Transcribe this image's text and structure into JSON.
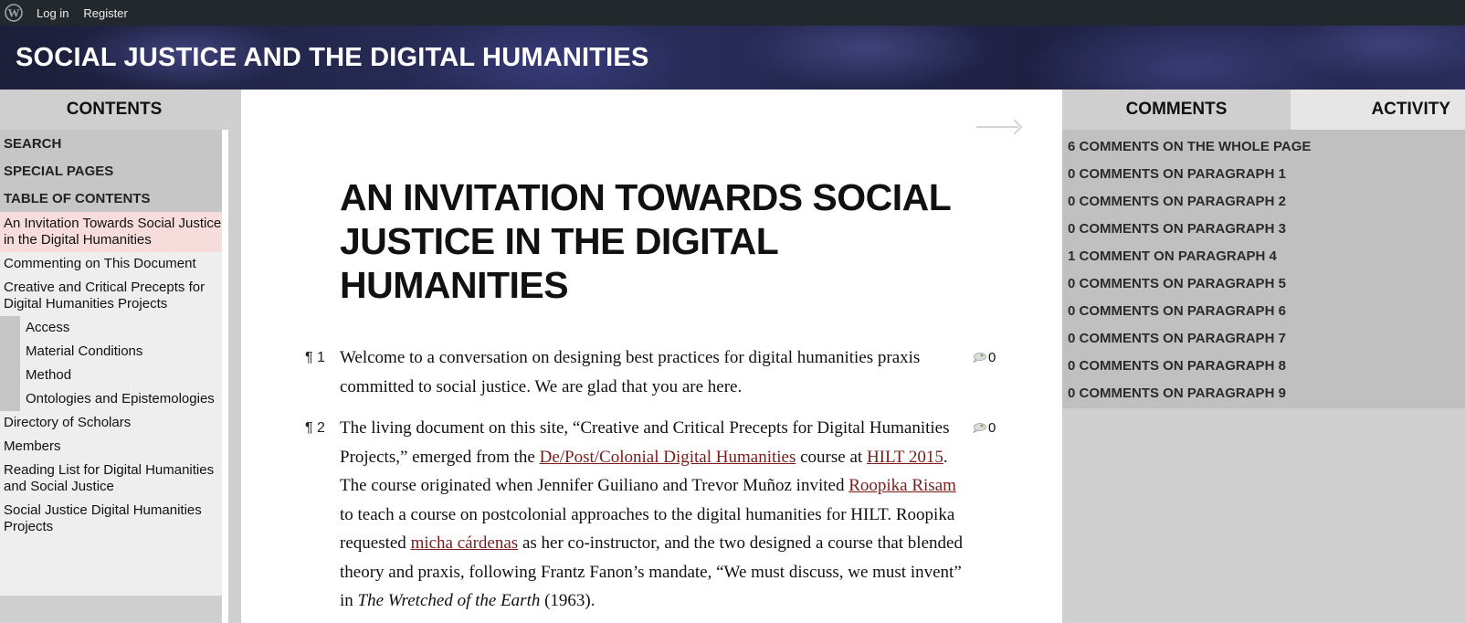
{
  "adminbar": {
    "login": "Log in",
    "register": "Register"
  },
  "site": {
    "title": "SOCIAL JUSTICE AND THE DIGITAL HUMANITIES"
  },
  "left": {
    "tab": "CONTENTS",
    "caps": [
      "SEARCH",
      "SPECIAL PAGES",
      "TABLE OF CONTENTS"
    ],
    "toc_top": [
      "An Invitation Towards Social Justice in the Digital Humanities",
      "Commenting on This Document",
      "Creative and Critical Precepts for Digital Humanities Projects"
    ],
    "toc_sub": [
      "Access",
      "Material Conditions",
      "Method",
      "Ontologies and Epistemologies"
    ],
    "toc_bottom": [
      "Directory of Scholars",
      "Members",
      "Reading List for Digital Humanities and Social Justice",
      "Social Justice Digital Humanities Projects"
    ]
  },
  "main": {
    "title": "AN INVITATION TOWARDS SOCIAL JUSTICE IN THE DIGITAL HUMANITIES",
    "paragraphs": [
      {
        "num": "¶ 1",
        "count": "0",
        "text": "Welcome to a conversation on designing best practices for digital humanities praxis committed to social justice. We are glad that you are here."
      },
      {
        "num": "¶ 2",
        "count": "0",
        "t1": "The living document on this site, “Creative and Critical Precepts for Digital Humanities Projects,” emerged from the ",
        "l1": "De/Post/Colonial Digital Humanities",
        "t2": " course at ",
        "l2": "HILT 2015",
        "t3": ". The course originated when Jennifer Guiliano and Trevor Muñoz invited ",
        "l3": "Roopika Risam",
        "t4": " to teach a course on postcolonial approaches to the digital humanities for HILT. Roopika requested ",
        "l4": "micha cárdenas",
        "t5": " as her co-instructor, and the two designed a course that blended theory and praxis, following Frantz Fanon’s mandate, “We must discuss, we must invent” in ",
        "i1": "The Wretched of the Earth",
        "t6": " (1963)."
      }
    ]
  },
  "right": {
    "tab_comments": "COMMENTS",
    "tab_activity": "ACTIVITY",
    "items": [
      "6 COMMENTS ON THE WHOLE PAGE",
      "0 COMMENTS ON PARAGRAPH 1",
      "0 COMMENTS ON PARAGRAPH 2",
      "0 COMMENTS ON PARAGRAPH 3",
      "1 COMMENT ON PARAGRAPH 4",
      "0 COMMENTS ON PARAGRAPH 5",
      "0 COMMENTS ON PARAGRAPH 6",
      "0 COMMENTS ON PARAGRAPH 7",
      "0 COMMENTS ON PARAGRAPH 8",
      "0 COMMENTS ON PARAGRAPH 9"
    ]
  },
  "icons": {
    "logo": "wordpress-logo-icon",
    "next": "arrow-right-icon",
    "comment": "comment-bubble-icon"
  },
  "colors": {
    "adminbar": "#23282d",
    "link": "#7a1c1c",
    "active_item": "#f7dcdc"
  }
}
